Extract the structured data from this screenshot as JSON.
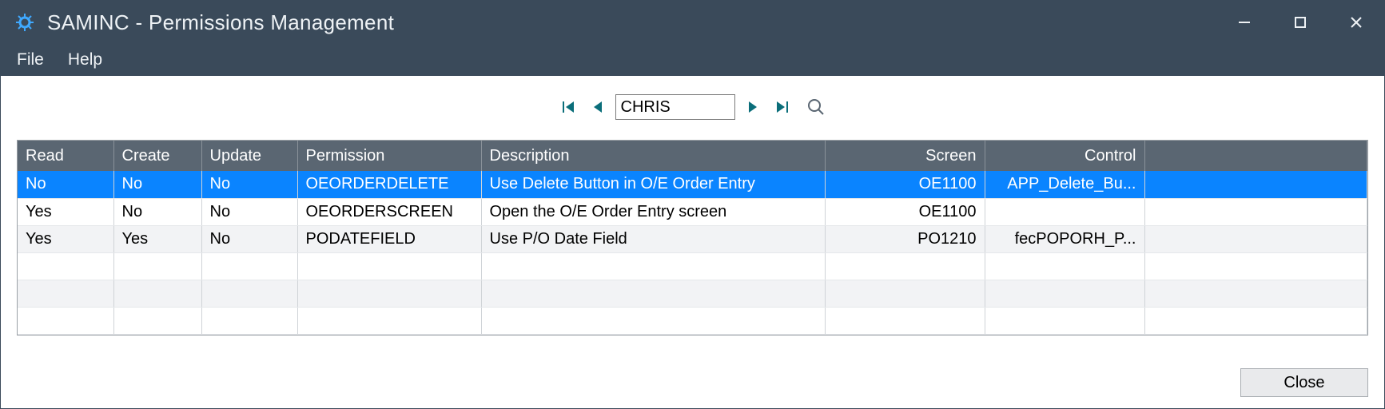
{
  "window": {
    "title": "SAMINC - Permissions Management"
  },
  "menu": {
    "file": "File",
    "help": "Help"
  },
  "nav": {
    "value": "CHRIS"
  },
  "grid": {
    "headers": {
      "read": "Read",
      "create": "Create",
      "update": "Update",
      "permission": "Permission",
      "description": "Description",
      "screen": "Screen",
      "control": "Control"
    },
    "rows": [
      {
        "read": "No",
        "create": "No",
        "update": "No",
        "permission": "OEORDERDELETE",
        "description": "Use Delete Button in O/E Order Entry",
        "screen": "OE1100",
        "control": "APP_Delete_Bu...",
        "selected": true
      },
      {
        "read": "Yes",
        "create": "No",
        "update": "No",
        "permission": "OEORDERSCREEN",
        "description": "Open the O/E Order Entry screen",
        "screen": "OE1100",
        "control": "",
        "selected": false
      },
      {
        "read": "Yes",
        "create": "Yes",
        "update": "No",
        "permission": "PODATEFIELD",
        "description": "Use P/O Date Field",
        "screen": "PO1210",
        "control": "fecPOPORH_P...",
        "selected": false
      }
    ]
  },
  "footer": {
    "close": "Close"
  }
}
